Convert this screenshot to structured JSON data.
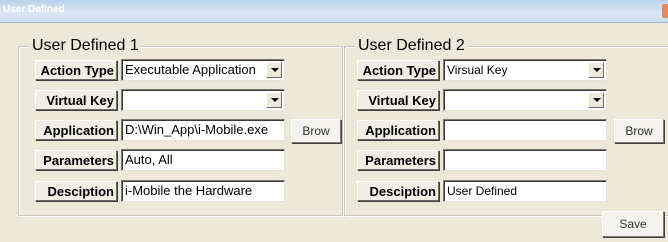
{
  "window": {
    "title": "User Defined"
  },
  "group1": {
    "legend": "User Defined 1",
    "labels": {
      "action_type": "Action Type",
      "virtual_key": "Virtual Key",
      "application": "Application",
      "parameters": "Parameters",
      "description": "Desciption"
    },
    "values": {
      "action_type": "Executable Application",
      "virtual_key": "",
      "application": "D:\\Win_App\\i-Mobile.exe",
      "parameters": "Auto, All",
      "description": "i-Mobile the Hardware"
    },
    "browse_label": "Brow"
  },
  "group2": {
    "legend": "User Defined 2",
    "labels": {
      "action_type": "Action Type",
      "virtual_key": "Virtual Key",
      "application": "Application",
      "parameters": "Parameters",
      "description": "Desciption"
    },
    "values": {
      "action_type": "Virsual Key",
      "virtual_key": "",
      "application": "",
      "parameters": "",
      "description": "User Defined"
    },
    "browse_label": "Brow"
  },
  "footer": {
    "save_label": "Save"
  }
}
